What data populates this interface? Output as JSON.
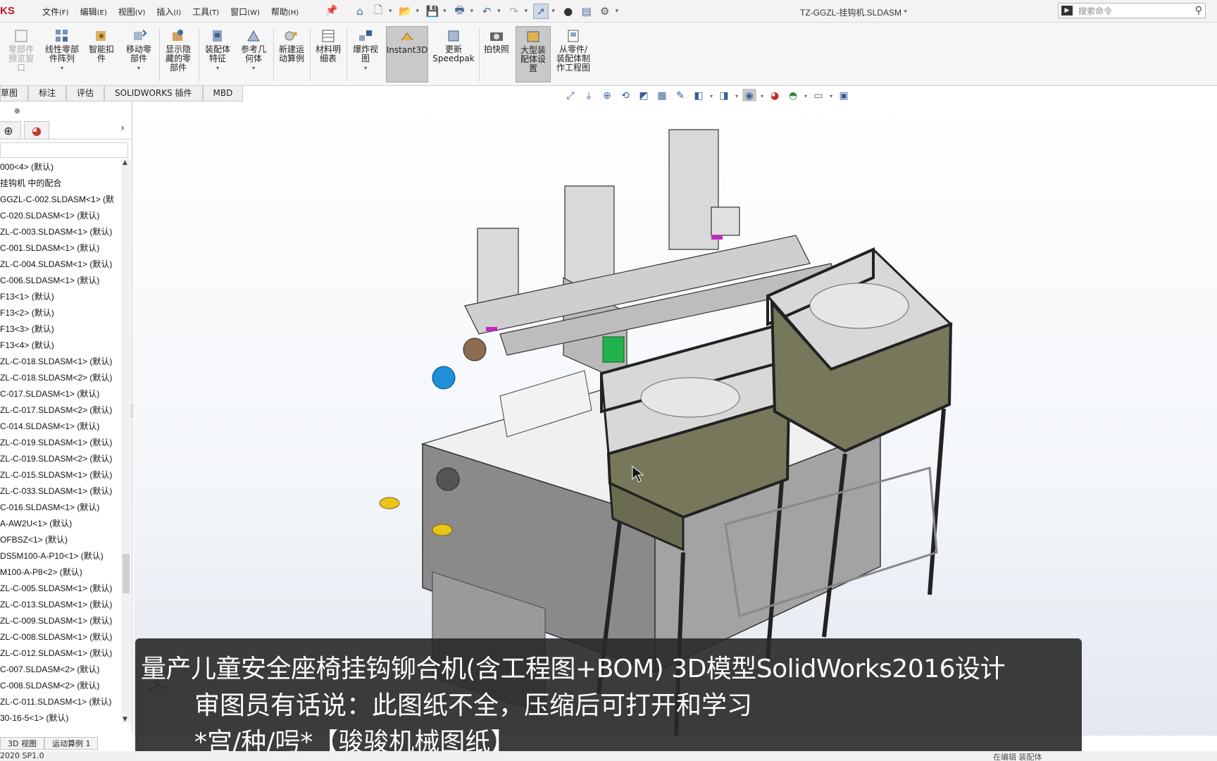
{
  "app": {
    "logo_fragment": "KS",
    "document_title": "TZ-GGZL-挂钩机.SLDASM *",
    "version": "2020 SP1.0"
  },
  "menu": [
    {
      "label": "文件",
      "key": "(F)"
    },
    {
      "label": "编辑",
      "key": "(E)"
    },
    {
      "label": "视图",
      "key": "(V)"
    },
    {
      "label": "插入",
      "key": "(I)"
    },
    {
      "label": "工具",
      "key": "(T)"
    },
    {
      "label": "窗口",
      "key": "(W)"
    },
    {
      "label": "帮助",
      "key": "(H)"
    }
  ],
  "search": {
    "placeholder": "搜索命令"
  },
  "ribbon": {
    "buttons": [
      {
        "lines": [
          "零部件",
          "预览窗",
          "口"
        ]
      },
      {
        "lines": [
          "线性零部",
          "件阵列"
        ]
      },
      {
        "lines": [
          "智能扣",
          "件"
        ]
      },
      {
        "lines": [
          "移动零",
          "部件"
        ]
      },
      {
        "lines": [
          "显示隐",
          "藏的零",
          "部件"
        ]
      },
      {
        "lines": [
          "装配体",
          "特征"
        ]
      },
      {
        "lines": [
          "参考几",
          "何体"
        ]
      },
      {
        "lines": [
          "新建运",
          "动算例"
        ]
      },
      {
        "lines": [
          "材料明",
          "细表"
        ]
      },
      {
        "lines": [
          "爆炸视",
          "图"
        ]
      },
      {
        "lines": [
          "Instant3D"
        ]
      },
      {
        "lines": [
          "更新",
          "Speedpak"
        ]
      },
      {
        "lines": [
          "拍快照"
        ]
      },
      {
        "lines": [
          "大型装",
          "配体设",
          "置"
        ]
      },
      {
        "lines": [
          "从零件/",
          "装配体制",
          "作工程图"
        ]
      }
    ]
  },
  "command_tabs": [
    "草图",
    "标注",
    "评估",
    "SOLIDWORKS 插件",
    "MBD"
  ],
  "feature_tree": [
    "000<4> (默认)",
    "挂钩机 中的配合",
    "GGZL-C-002.SLDASM<1> (默",
    "C-020.SLDASM<1> (默认)",
    "ZL-C-003.SLDASM<1> (默认)",
    "C-001.SLDASM<1> (默认)",
    "ZL-C-004.SLDASM<1> (默认)",
    "C-006.SLDASM<1> (默认)",
    "F13<1> (默认)",
    "F13<2> (默认)",
    "F13<3> (默认)",
    "F13<4> (默认)",
    "ZL-C-018.SLDASM<1> (默认)",
    "ZL-C-018.SLDASM<2> (默认)",
    "C-017.SLDASM<1> (默认)",
    "ZL-C-017.SLDASM<2> (默认)",
    "C-014.SLDASM<1> (默认)",
    "ZL-C-019.SLDASM<1> (默认)",
    "ZL-C-019.SLDASM<2> (默认)",
    "ZL-C-015.SLDASM<1> (默认)",
    "ZL-C-033.SLDASM<1> (默认)",
    "C-016.SLDASM<1> (默认)",
    "A-AW2U<1> (默认)",
    "OFBSZ<1> (默认)",
    "DS5M100-A-P10<1> (默认)",
    "M100-A-P8<2> (默认)",
    "ZL-C-005.SLDASM<1> (默认)",
    "ZL-C-013.SLDASM<1> (默认)",
    "ZL-C-009.SLDASM<1> (默认)",
    "ZL-C-008.SLDASM<1> (默认)",
    "ZL-C-012.SLDASM<1> (默认)",
    "C-007.SLDASM<2> (默认)",
    "C-008.SLDASM<2> (默认)",
    "ZL-C-011.SLDASM<1> (默认)",
    "30-16-5<1> (默认)"
  ],
  "bottom_tabs": [
    "3D 视图",
    "运动算例 1"
  ],
  "status_right": "在编辑 装配体",
  "overlay": {
    "line1": "量产儿童安全座椅挂钩铆合机(含工程图+BOM) 3D模型SolidWorks2016设计",
    "line2": "审图员有话说：此图纸不全，压缩后可打开和学习",
    "line3": "*宫/种/呺*【骏骏机械图纸】"
  },
  "colors": {
    "logo": "#c8102e",
    "frame_dark": "#2a2a2a",
    "hopper_panel": "#77775c",
    "table_body": "#8c8c8c",
    "accent_blue": "#1f8fd8",
    "accent_green": "#22b24c",
    "accent_magenta": "#c02ac0",
    "foot_yellow": "#e9c419"
  }
}
